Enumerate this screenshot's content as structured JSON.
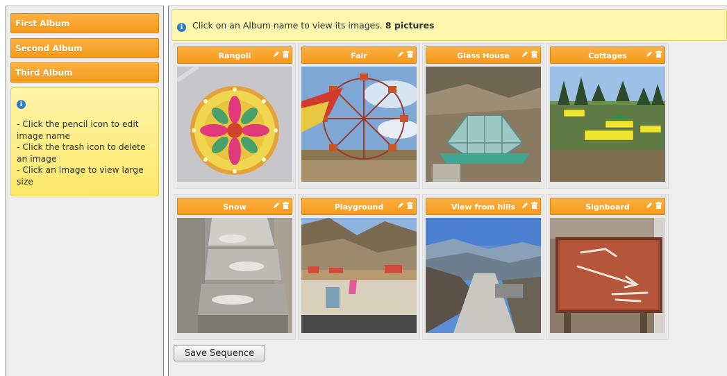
{
  "colors": {
    "accent_orange": "#f7a52a",
    "help_yellow": "#fde86a",
    "info_blue": "#2f7bc8",
    "panel_gray": "#eeeeee"
  },
  "sidebar": {
    "albums": [
      {
        "label": "First Album"
      },
      {
        "label": "Second Album"
      },
      {
        "label": "Third Album"
      }
    ],
    "help": {
      "icon": "info-icon",
      "lines": [
        "- Click the pencil icon to edit image name",
        "- Click the trash icon to delete an image",
        "- Click an image to view large size"
      ]
    }
  },
  "main": {
    "info_bar": {
      "icon": "info-icon",
      "text": "Click on an Album name to view its images.",
      "count": "8 pictures"
    },
    "images": [
      {
        "title": "Rangoli"
      },
      {
        "title": "Fair"
      },
      {
        "title": "Glass House"
      },
      {
        "title": "Cottages"
      },
      {
        "title": "Snow"
      },
      {
        "title": "Playground"
      },
      {
        "title": "View from hills"
      },
      {
        "title": "Signboard"
      }
    ],
    "save_label": "Save Sequence"
  }
}
